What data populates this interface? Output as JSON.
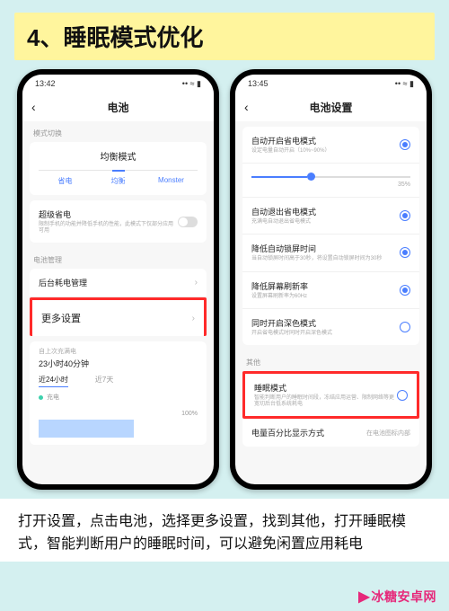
{
  "banner": {
    "title": "4、睡眠模式优化"
  },
  "phone_left": {
    "status": {
      "time": "13:42",
      "right": "•• ≈ ▮"
    },
    "nav": {
      "back": "‹",
      "title": "电池"
    },
    "mode_section_label": "模式切换",
    "mode_title": "均衡模式",
    "mode_tabs": [
      "省电",
      "均衡",
      "Monster"
    ],
    "super_save": {
      "label": "超级省电",
      "sub": "限制手机的功能并降低手机的性能，此模式下仅部分应用可用"
    },
    "manage_label": "电池管理",
    "bg_manage": {
      "label": "后台耗电管理"
    },
    "more_settings": {
      "label": "更多设置"
    },
    "chart": {
      "since_label": "自上次充满电",
      "duration": "23小时40分钟",
      "tabs": [
        "近24小时",
        "近7天"
      ],
      "legend": "充电",
      "pct": "100%"
    }
  },
  "phone_right": {
    "status": {
      "time": "13:45",
      "right": "•• ≈ ▮"
    },
    "nav": {
      "back": "‹",
      "title": "电池设置"
    },
    "items": [
      {
        "label": "自动开启省电模式",
        "sub": "设定电量自动开启（10%~90%）"
      },
      {
        "label": "自动退出省电模式",
        "sub": "充满电自动退出省电模式"
      },
      {
        "label": "降低自动锁屏时间",
        "sub": "当自动锁屏时间高于30秒，将设置自动锁屏时间为30秒"
      },
      {
        "label": "降低屏幕刷新率",
        "sub": "设置屏幕刷新率为60Hz"
      },
      {
        "label": "同时开启深色模式",
        "sub": "开启省电模式时同时开启深色模式"
      }
    ],
    "slider": {
      "value": "35%"
    },
    "other_label": "其他",
    "sleep": {
      "label": "睡眠模式",
      "sub": "智能判断用户的睡眠时间段，冻结应用运营、限制网络等更宽切后台低系统耗电"
    },
    "display": {
      "label": "电量百分比显示方式",
      "value": "在电池图标内部"
    }
  },
  "caption": "打开设置，点击电池，选择更多设置，找到其他，打开睡眠模式，智能判断用户的睡眠时间，可以避免闲置应用耗电",
  "footer": "冰糖安卓网"
}
